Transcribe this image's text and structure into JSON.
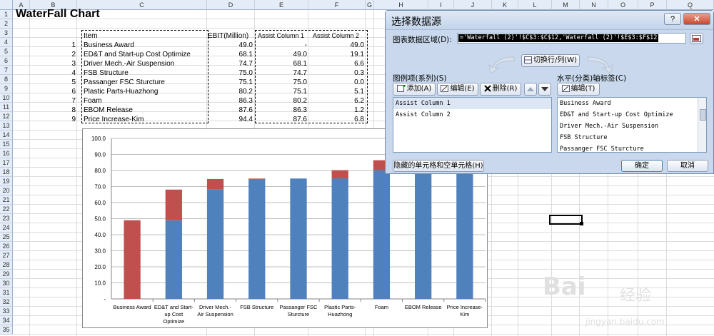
{
  "sheet": {
    "columns": [
      "A",
      "B",
      "C",
      "D",
      "E",
      "F",
      "G",
      "H",
      "I",
      "J",
      "K",
      "L",
      "M",
      "N",
      "O",
      "P",
      "Q"
    ],
    "rows": [
      "1",
      "2",
      "3",
      "4",
      "5",
      "6",
      "7",
      "8",
      "9",
      "10",
      "11",
      "12",
      "13",
      "14",
      "15",
      "16",
      "17",
      "18",
      "19",
      "20",
      "21",
      "22",
      "23",
      "24",
      "25",
      "26",
      "27",
      "28",
      "29",
      "30",
      "31",
      "32",
      "33",
      "34",
      "35"
    ],
    "title": "WaterFall Chart",
    "headers": {
      "item": "Item",
      "ebit": "EBIT(Million)",
      "assist1": "Assist Column 1",
      "assist2": "Assist Column 2"
    },
    "table": [
      {
        "idx": "1",
        "item": "Business Award",
        "ebit": "49.0",
        "a1": "-",
        "a2": "49.0"
      },
      {
        "idx": "2",
        "item": "ED&T and Start-up Cost Optimize",
        "ebit": "68.1",
        "a1": "49.0",
        "a2": "19.1"
      },
      {
        "idx": "3",
        "item": "Driver Mech.-Air Suspension",
        "ebit": "74.7",
        "a1": "68.1",
        "a2": "6.6"
      },
      {
        "idx": "4",
        "item": "FSB Structure",
        "ebit": "75.0",
        "a1": "74.7",
        "a2": "0.3"
      },
      {
        "idx": "5",
        "item": "Passanger FSC Sturcture",
        "ebit": "75.1",
        "a1": "75.0",
        "a2": "0.0"
      },
      {
        "idx": "6",
        "item": "Plastic Parts-Huazhong",
        "ebit": "80.2",
        "a1": "75.1",
        "a2": "5.1"
      },
      {
        "idx": "7",
        "item": "Foam",
        "ebit": "86.3",
        "a1": "80.2",
        "a2": "6.2"
      },
      {
        "idx": "8",
        "item": "EBOM Release",
        "ebit": "87.6",
        "a1": "86.3",
        "a2": "1.2"
      },
      {
        "idx": "9",
        "item": "Price Increase-Kim",
        "ebit": "94.4",
        "a1": "87.6",
        "a2": "6.8"
      }
    ]
  },
  "chart_data": {
    "type": "bar",
    "stacked": true,
    "categories": [
      "Business Award",
      "ED&T and Start-up Cost Optimize",
      "Driver Mech.-Air Suspension",
      "FSB Structure",
      "Passanger FSC Sturcture",
      "Plastic Parts-Huazhong",
      "Foam",
      "EBOM Release",
      "Price Increase-Kim"
    ],
    "category_label_lines": [
      [
        "Business Award"
      ],
      [
        "ED&T and Start-",
        "up Cost",
        "Optimize"
      ],
      [
        "Driver Mech.-",
        "Air Suspension"
      ],
      [
        "FSB Structure"
      ],
      [
        "Passanger FSC",
        "Sturcture"
      ],
      [
        "Plastic Parts-",
        "Huazhong"
      ],
      [
        "Foam"
      ],
      [
        "EBOM Release"
      ],
      [
        "Price Increase-",
        "Kim"
      ]
    ],
    "series": [
      {
        "name": "Assist Column 1",
        "values": [
          0,
          49.0,
          68.1,
          74.7,
          75.0,
          75.1,
          80.2,
          86.3,
          87.6
        ],
        "color": "#4f81bd"
      },
      {
        "name": "Assist Column 2",
        "values": [
          49.0,
          19.1,
          6.6,
          0.3,
          0.0,
          5.1,
          6.2,
          1.2,
          6.8
        ],
        "color": "#c0504d"
      }
    ],
    "yticks": [
      "100.0",
      "90.0",
      "80.0",
      "70.0",
      "60.0",
      "50.0",
      "40.0",
      "30.0",
      "20.0",
      "10.0",
      "-"
    ],
    "ylim": [
      0,
      100
    ],
    "grid": true
  },
  "dialog": {
    "title": "选择数据源",
    "help_btn": "?",
    "close_btn": "✕",
    "range_label": "图表数据区域(D):",
    "range_value": "='Waterfall (2)'!$C$3:$C$12,'Waterfall (2)'!$E$3:$F$12",
    "switch_btn": "切换行/列(W)",
    "legend_label": "图例项(系列)(S)",
    "add_btn": "添加(A)",
    "edit_btn": "编辑(E)",
    "delete_btn": "删除(R)",
    "axis_label": "水平(分类)轴标签(C)",
    "axis_edit_btn": "编辑(T)",
    "series_list": [
      "Assist Column 1",
      "Assist Column 2"
    ],
    "axis_list": [
      "Business Award",
      "ED&T and Start-up Cost Optimize",
      "Driver Mech.-Air Suspension",
      "FSB Structure",
      "Passanger FSC Sturcture"
    ],
    "hidden_btn": "隐藏的单元格和空单元格(H)",
    "ok_btn": "确定",
    "cancel_btn": "取消"
  },
  "watermark": {
    "brand": "Bai",
    "brand_cn": "经验",
    "url": "jingyan.baidu.com"
  }
}
